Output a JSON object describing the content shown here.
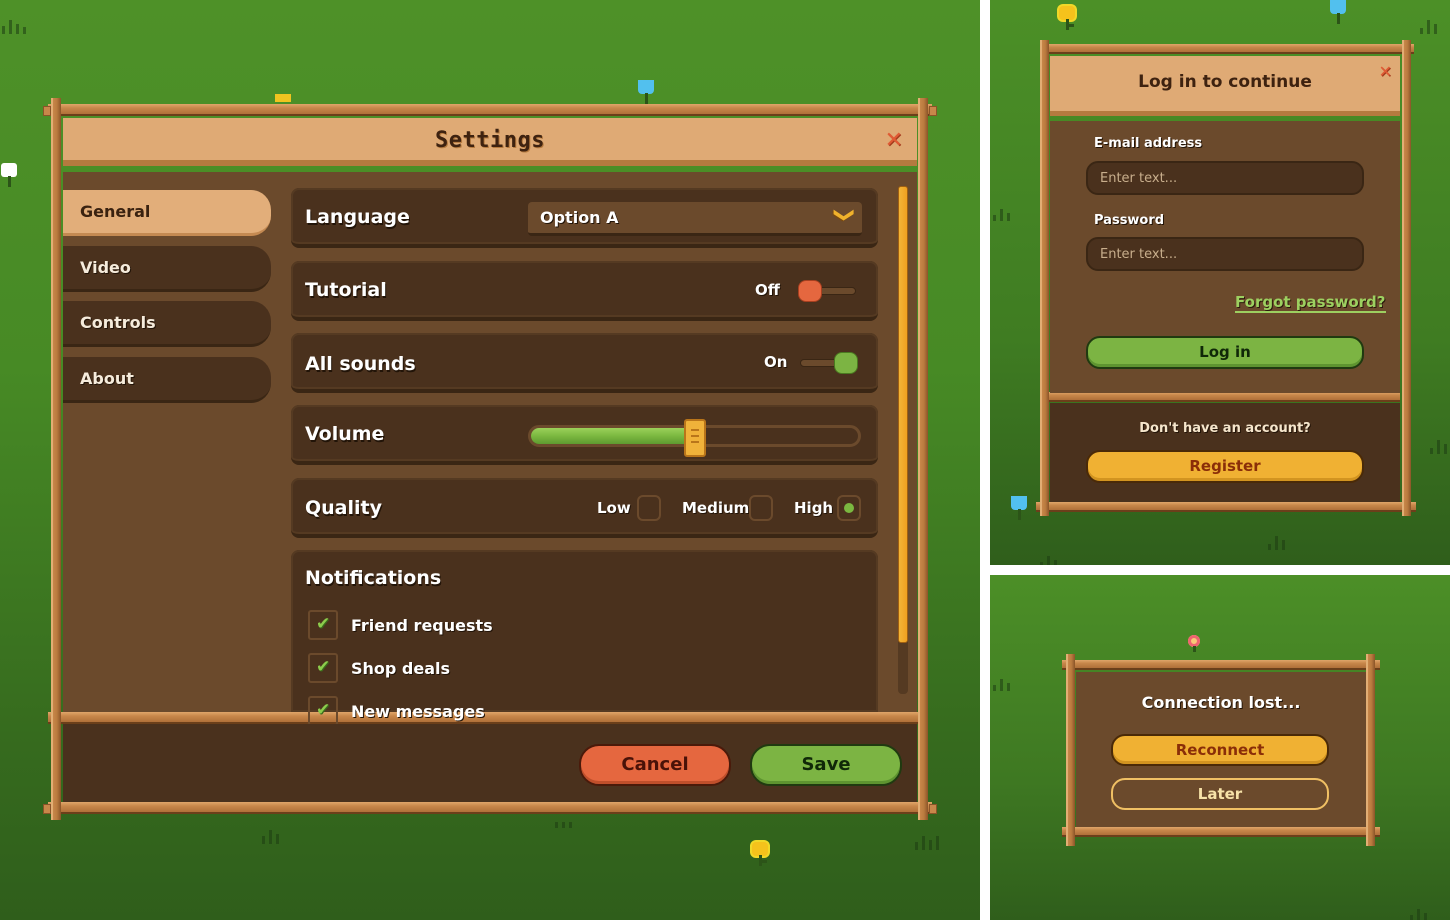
{
  "settings": {
    "title": "Settings",
    "close_icon": "✕",
    "tabs": [
      {
        "label": "General",
        "active": true
      },
      {
        "label": "Video",
        "active": false
      },
      {
        "label": "Controls",
        "active": false
      },
      {
        "label": "About",
        "active": false
      }
    ],
    "language": {
      "label": "Language",
      "value": "Option A",
      "chevron": "❯"
    },
    "tutorial": {
      "label": "Tutorial",
      "state_label": "Off",
      "on": false
    },
    "all_sounds": {
      "label": "All sounds",
      "state_label": "On",
      "on": true
    },
    "volume": {
      "label": "Volume",
      "value_fraction": 0.5
    },
    "quality": {
      "label": "Quality",
      "options": [
        {
          "label": "Low",
          "selected": false
        },
        {
          "label": "Medium",
          "selected": false
        },
        {
          "label": "High",
          "selected": true
        }
      ]
    },
    "notifications": {
      "label": "Notifications",
      "items": [
        {
          "label": "Friend requests",
          "checked": true
        },
        {
          "label": "Shop deals",
          "checked": true
        },
        {
          "label": "New messages",
          "checked": true
        }
      ]
    },
    "scroll_fraction": 0.9,
    "cancel_label": "Cancel",
    "save_label": "Save",
    "colors": {
      "header": "#dfaa75",
      "panel": "#6b4a2c",
      "row": "#4a311d",
      "accent_green": "#7cb443",
      "accent_red": "#e5673f",
      "accent_yellow": "#f0b133"
    }
  },
  "login": {
    "title": "Log in to continue",
    "close_icon": "✕",
    "email_label": "E-mail address",
    "email_placeholder": "Enter text...",
    "password_label": "Password",
    "password_placeholder": "Enter text...",
    "forgot_label": "Forgot password?",
    "login_label": "Log in",
    "no_account_label": "Don't have an account?",
    "register_label": "Register"
  },
  "connection": {
    "message": "Connection lost...",
    "reconnect_label": "Reconnect",
    "later_label": "Later"
  }
}
